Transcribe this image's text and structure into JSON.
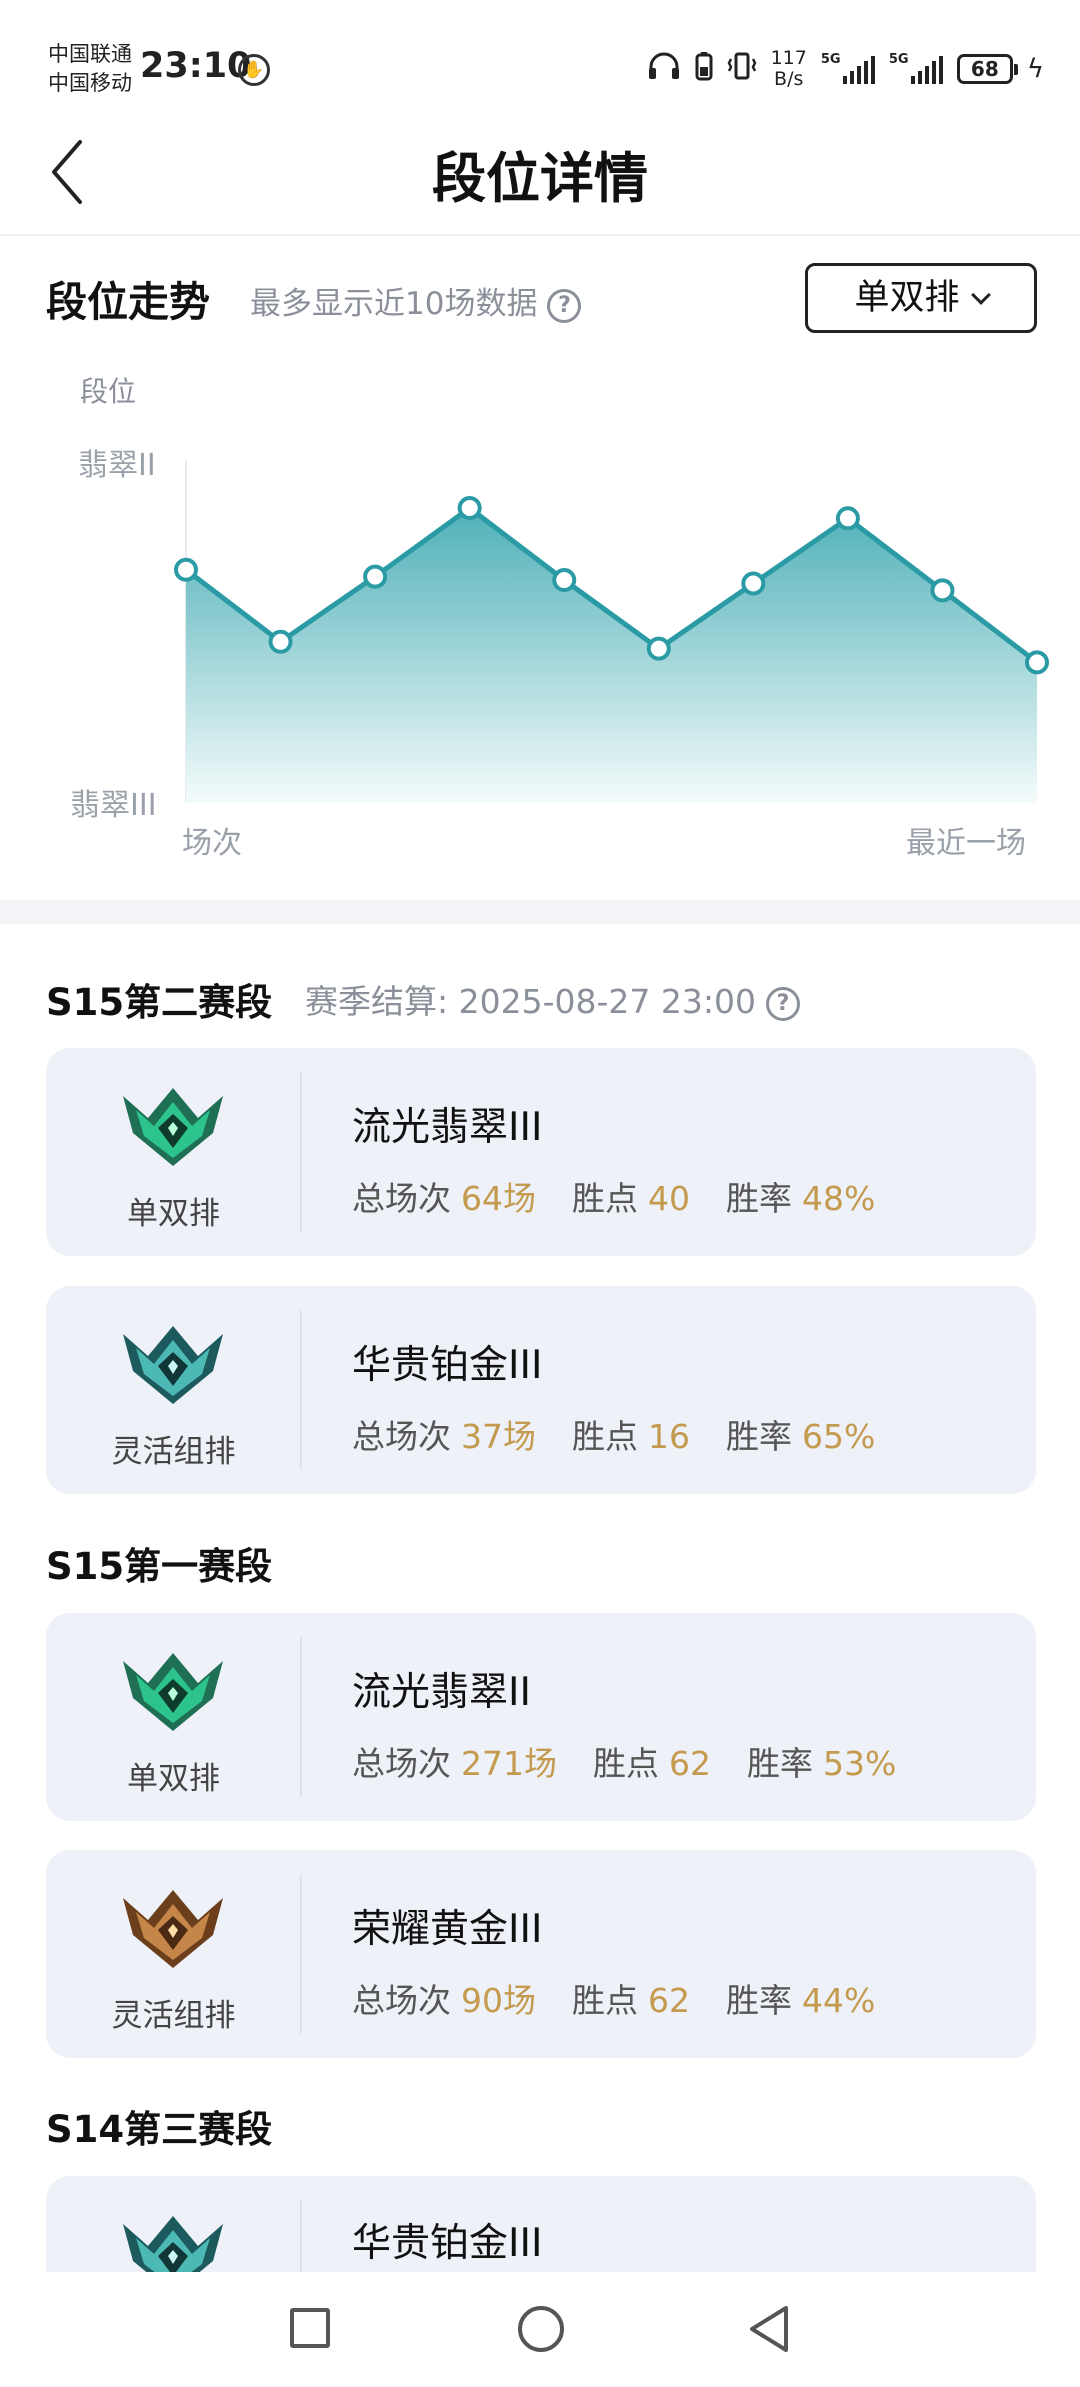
{
  "status_bar": {
    "carrier_1": "中国联通",
    "carrier_2": "中国移动",
    "time": "23:10",
    "net_speed_value": "117",
    "net_speed_unit": "B/s",
    "signal_1_tag": "5G",
    "signal_2_tag": "5G",
    "battery": "68"
  },
  "header": {
    "title": "段位详情"
  },
  "trend": {
    "title": "段位走势",
    "subtitle": "最多显示近10场数据",
    "help": "?",
    "queue_select": "单双排"
  },
  "chart_data": {
    "type": "area",
    "ylabel": "段位",
    "y_ticks": [
      "翡翠II",
      "翡翠III"
    ],
    "x_start_label": "场次",
    "x_end_label": "最近一场",
    "x": [
      1,
      2,
      3,
      4,
      5,
      6,
      7,
      8,
      9,
      10
    ],
    "values": [
      0.68,
      0.47,
      0.66,
      0.86,
      0.65,
      0.45,
      0.64,
      0.83,
      0.62,
      0.41
    ],
    "colors": {
      "line": "#2a9aa5",
      "fill_top": "#4fb0b8",
      "fill_bottom": "#f4fbfb"
    }
  },
  "seasons": [
    {
      "name": "S15第二赛段",
      "note": "赛季结算: 2025-08-27 23:00",
      "cards": [
        {
          "queue": "单双排",
          "rank": "流光翡翠III",
          "games_label": "总场次",
          "games": "64场",
          "lp_label": "胜点",
          "lp": "40",
          "wr_label": "胜率",
          "wr": "48%",
          "emblem": "emerald-emblem-icon"
        },
        {
          "queue": "灵活组排",
          "rank": "华贵铂金III",
          "games_label": "总场次",
          "games": "37场",
          "lp_label": "胜点",
          "lp": "16",
          "wr_label": "胜率",
          "wr": "65%",
          "emblem": "platinum-emblem-icon"
        }
      ]
    },
    {
      "name": "S15第一赛段",
      "cards": [
        {
          "queue": "单双排",
          "rank": "流光翡翠II",
          "games_label": "总场次",
          "games": "271场",
          "lp_label": "胜点",
          "lp": "62",
          "wr_label": "胜率",
          "wr": "53%",
          "emblem": "emerald-emblem-icon"
        },
        {
          "queue": "灵活组排",
          "rank": "荣耀黄金III",
          "games_label": "总场次",
          "games": "90场",
          "lp_label": "胜点",
          "lp": "62",
          "wr_label": "胜率",
          "wr": "44%",
          "emblem": "gold-emblem-icon"
        }
      ]
    },
    {
      "name": "S14第三赛段",
      "cards": [
        {
          "rank": "华贵铂金III",
          "emblem": "platinum-emblem-icon"
        }
      ]
    }
  ]
}
